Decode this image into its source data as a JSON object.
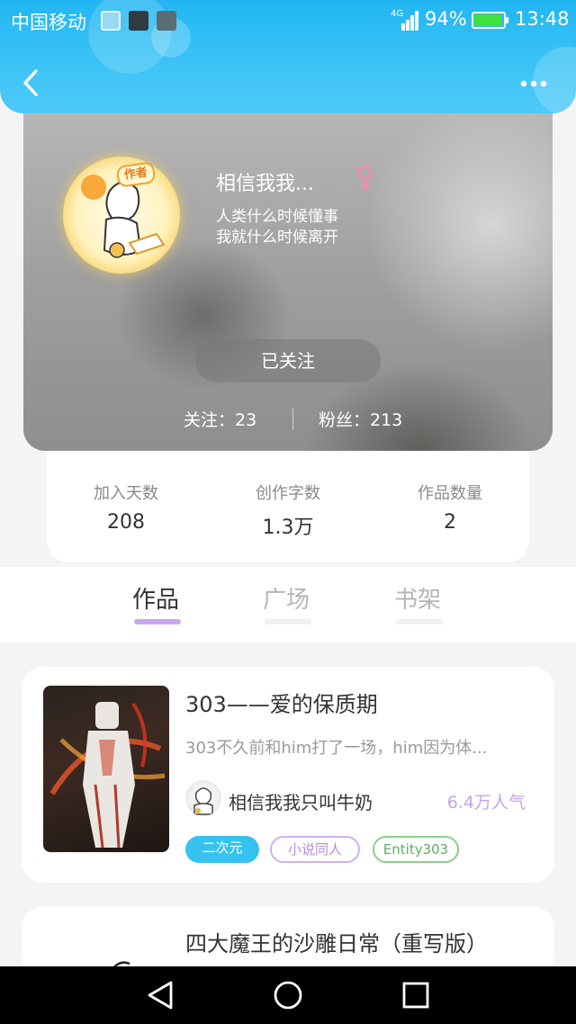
{
  "status_bar": {
    "carrier": "中国移动",
    "network": "4G",
    "battery_percent": "94%",
    "battery_level": 0.94,
    "time": "13:48",
    "icons": [
      "gallery-icon",
      "app-thumbnail-icon",
      "app-thumbnail-icon"
    ],
    "signal_bars": 4
  },
  "header": {
    "back_icon": "chevron-left-icon",
    "more_icon": "more-horizontal-icon"
  },
  "profile": {
    "avatar_badge": "作者",
    "nickname": "相信我我...",
    "gender_icon": "female-icon",
    "bio_lines": [
      "人类什么时候懂事",
      "我就什么时候离开"
    ],
    "follow_button": "已关注",
    "following_label": "关注：23",
    "fans_label": "粉丝：213"
  },
  "stats": [
    {
      "label": "加入天数",
      "value": "208"
    },
    {
      "label": "创作字数",
      "value": "1.3万"
    },
    {
      "label": "作品数量",
      "value": "2"
    }
  ],
  "tabs": [
    {
      "label": "作品",
      "active": true
    },
    {
      "label": "广场",
      "active": false
    },
    {
      "label": "书架",
      "active": false
    }
  ],
  "works": [
    {
      "title": "303——爱的保质期",
      "description": "303不久前和him打了一场，him因为体...",
      "author": "相信我我只叫牛奶",
      "popularity": "6.4万人气",
      "tags": [
        "二次元",
        "小说同人",
        "Entity303"
      ]
    },
    {
      "title": "四大魔王的沙雕日常（重写版）"
    }
  ],
  "navbar": {
    "back_icon": "triangle-back-icon",
    "home_icon": "circle-home-icon",
    "recents_icon": "square-recents-icon"
  },
  "colors": {
    "header_blue": "#22b6f2",
    "accent_purple": "#c9a8f0",
    "tag_blue": "#36c2ee",
    "tag_purple": "#d1b0f2",
    "tag_green": "#8bd08b"
  }
}
